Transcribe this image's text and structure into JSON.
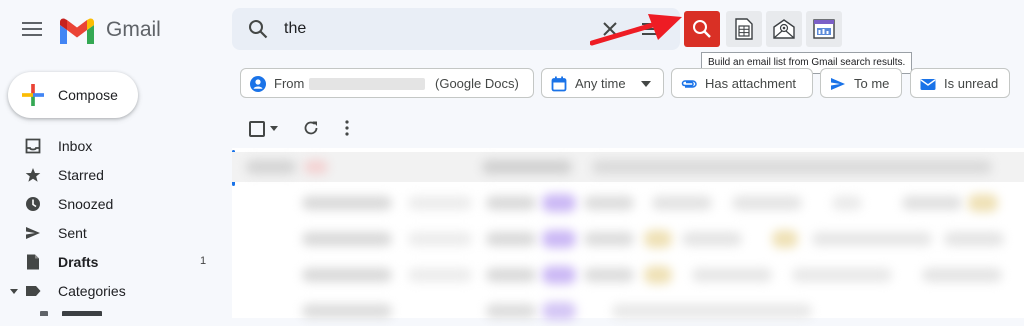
{
  "header": {
    "app_name": "Gmail",
    "search_query": "the"
  },
  "extensions": {
    "tooltip": "Build an email list from Gmail search results."
  },
  "sidebar": {
    "compose_label": "Compose",
    "items": [
      {
        "label": "Inbox",
        "icon": "inbox-icon",
        "count": ""
      },
      {
        "label": "Starred",
        "icon": "star-icon",
        "count": ""
      },
      {
        "label": "Snoozed",
        "icon": "clock-icon",
        "count": ""
      },
      {
        "label": "Sent",
        "icon": "send-icon",
        "count": ""
      },
      {
        "label": "Drafts",
        "icon": "draft-icon",
        "count": "1"
      },
      {
        "label": "Categories",
        "icon": "label-icon",
        "count": ""
      }
    ]
  },
  "filters": {
    "from_label": "From",
    "from_suffix": "(Google Docs)",
    "time_label": "Any time",
    "attachment_label": "Has attachment",
    "to_me_label": "To me",
    "unread_label": "Is unread"
  },
  "colors": {
    "accent_red": "#d93025",
    "chip_icon_blue": "#1a73e8",
    "selected_row_bar": "#1a73e8"
  }
}
